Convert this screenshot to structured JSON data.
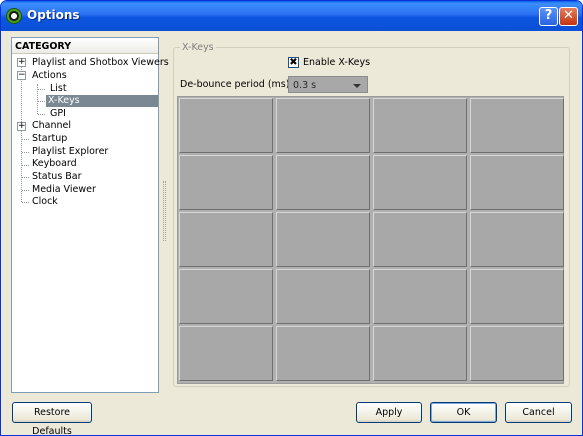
{
  "window": {
    "title": "Options",
    "help_label": "?",
    "close_label": "✕"
  },
  "sidebar": {
    "header": "CATEGORY",
    "items": [
      {
        "label": "Playlist and Shotbox Viewers",
        "expander": "+"
      },
      {
        "label": "Actions",
        "expander": "−"
      },
      {
        "label": "List"
      },
      {
        "label": "X-Keys",
        "selected": true
      },
      {
        "label": "GPI"
      },
      {
        "label": "Channel",
        "expander": "+"
      },
      {
        "label": "Startup"
      },
      {
        "label": "Playlist Explorer"
      },
      {
        "label": "Keyboard"
      },
      {
        "label": "Status Bar"
      },
      {
        "label": "Media Viewer"
      },
      {
        "label": "Clock"
      }
    ]
  },
  "panel": {
    "group_title": "X-Keys",
    "enable_label": "Enable X-Keys",
    "enable_checked": true,
    "enable_mark": "✖",
    "debounce_label": "De-bounce period (ms):",
    "debounce_value": "0.3 s",
    "key_grid": {
      "rows": 5,
      "columns": 4
    }
  },
  "footer": {
    "restore_label": "Restore Defaults",
    "apply_label": "Apply",
    "ok_label": "OK",
    "cancel_label": "Cancel"
  },
  "colors": {
    "titlebar": "#0c55e0",
    "selection": "#7a8894",
    "key_face": "#a8a8a8"
  }
}
